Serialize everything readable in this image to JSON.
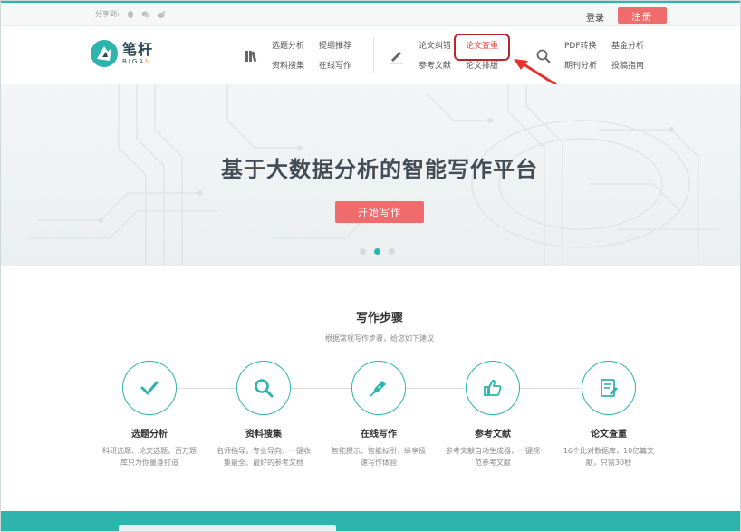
{
  "topbar": {
    "share_label": "分享到:",
    "share_icons": [
      "qq-icon",
      "wechat-icon",
      "weibo-icon"
    ],
    "login": "登录",
    "register": "注册"
  },
  "nav": {
    "logo_cn": "笔杆",
    "logo_en_prefix": "BIGA",
    "logo_en_suffix": "N",
    "group1": {
      "icon": "books-icon",
      "items": [
        "选题分析",
        "提纲推荐",
        "资料搜集",
        "在线写作"
      ]
    },
    "group2": {
      "icon": "pen-icon",
      "items": [
        "论文纠错",
        "论文查重",
        "参考文献",
        "论文排版"
      ]
    },
    "group3": {
      "icon": "search-icon",
      "items": [
        "PDF转换",
        "基金分析",
        "期刊分析",
        "投稿指南"
      ]
    }
  },
  "hero": {
    "title": "基于大数据分析的智能写作平台",
    "button": "开始写作",
    "slides": 3,
    "active_slide": 1
  },
  "steps": {
    "title": "写作步骤",
    "subtitle": "根据常规写作步骤，给您如下建议",
    "items": [
      {
        "icon": "check-icon",
        "name": "选题分析",
        "desc": "科研选题、论文选题，百万题库只为你量身打造"
      },
      {
        "icon": "magnifier-icon",
        "name": "资料搜集",
        "desc": "名师指导，专业导向，一键收集最全、最好的参考文档"
      },
      {
        "icon": "pen-nib-icon",
        "name": "在线写作",
        "desc": "智能提示、智能标引，纵享极速写作体验"
      },
      {
        "icon": "thumbs-up-icon",
        "name": "参考文献",
        "desc": "参考文献自动生成器，一键规范参考文献"
      },
      {
        "icon": "document-check-icon",
        "name": "论文查重",
        "desc": "16个比对数据库，10亿篇文献，只需30秒"
      }
    ]
  },
  "colors": {
    "accent": "#2fb3ad",
    "button": "#f06c6c",
    "highlight_box": "#b8272b",
    "arrow": "#e5322b"
  }
}
